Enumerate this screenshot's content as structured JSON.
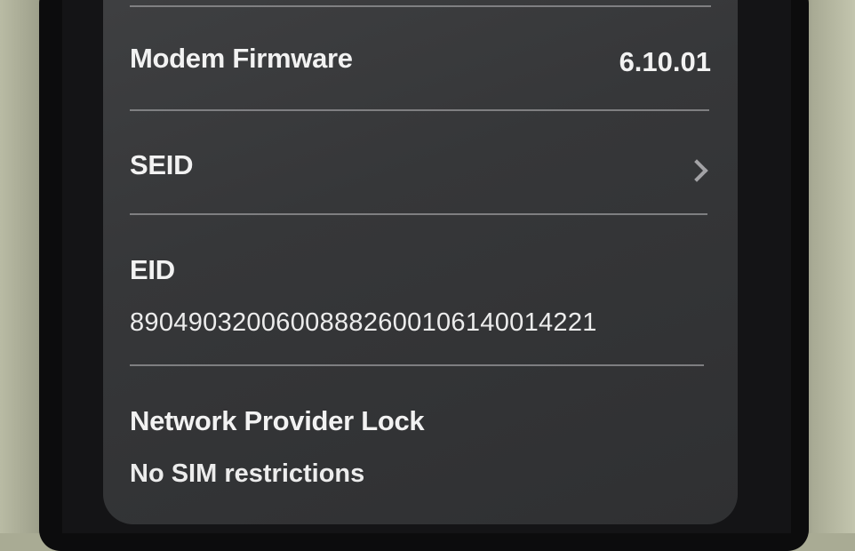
{
  "rows": [
    {
      "label": "Modem Firmware",
      "value": "6.10.01"
    },
    {
      "label": "SEID",
      "icon": "chevron-right-icon"
    },
    {
      "label": "EID",
      "value": "89049032006008882600106140014221"
    },
    {
      "label": "Network Provider Lock",
      "value": "No SIM restrictions"
    }
  ]
}
